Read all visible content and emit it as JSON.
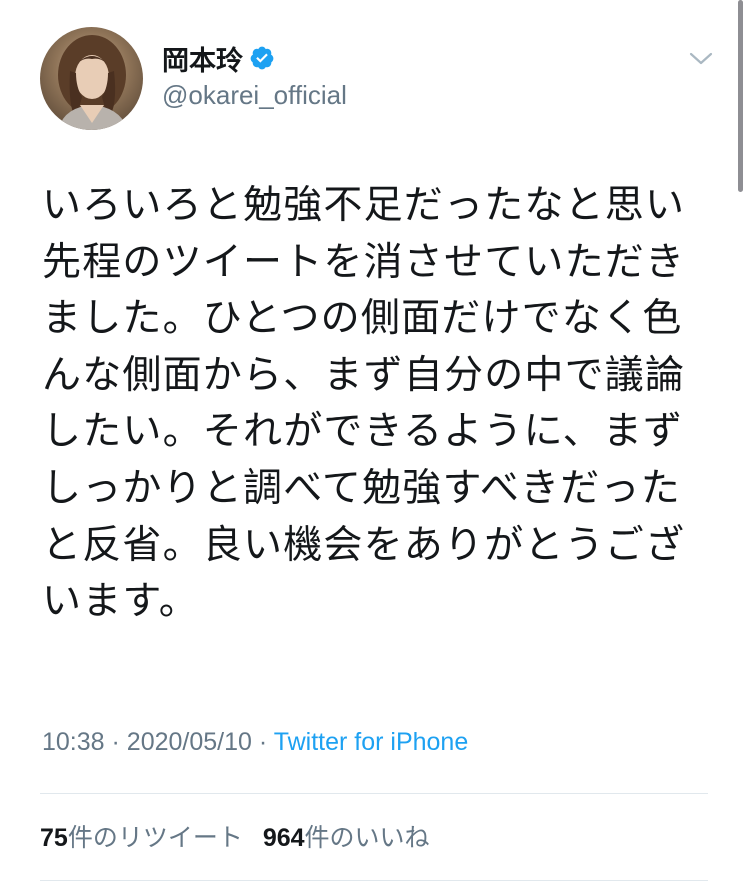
{
  "tweet": {
    "author": {
      "display_name": "岡本玲",
      "handle": "@okarei_official",
      "verified": true
    },
    "body_lines": [
      "いろいろと勉強不足だったなと思い",
      "先程のツイートを消させていただき",
      "ました。ひとつの側面だけでなく色",
      "んな側面から、まず自分の中で議論",
      "したい。それができるように、まず",
      "しっかりと調べて勉強すべきだった",
      "と反省。良い機会をありがとうござ",
      "います。"
    ],
    "time": "10:38",
    "date": "2020/05/10",
    "separator": "·",
    "source": "Twitter for iPhone",
    "stats": {
      "retweets_count": "75",
      "retweets_label": "件のリツイート",
      "likes_count": "964",
      "likes_label": "件のいいね"
    }
  },
  "colors": {
    "text_primary": "#14171a",
    "text_secondary": "#657786",
    "accent": "#1da1f2",
    "divider": "#e1e8ed"
  },
  "icons": {
    "verified": "verified-badge-icon",
    "menu": "chevron-down-icon"
  }
}
